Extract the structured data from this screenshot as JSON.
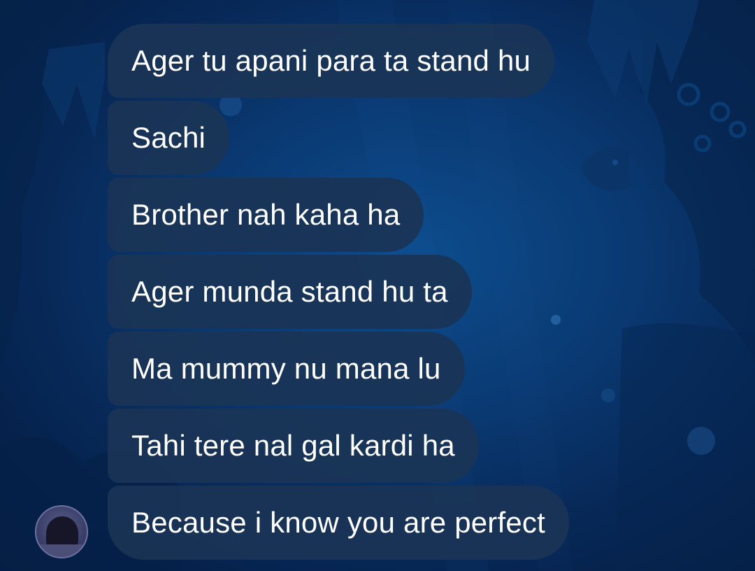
{
  "messages": [
    "Ager tu apani para ta stand hu",
    "Sachi",
    "Brother nah kaha ha",
    "Ager munda stand hu ta",
    "Ma mummy nu mana lu",
    "Tahi tere nal gal kardi ha",
    "Because i know you are perfect"
  ],
  "colors": {
    "bubble": "#1a3456",
    "text": "#ffffff",
    "background": "#0a3a73"
  }
}
